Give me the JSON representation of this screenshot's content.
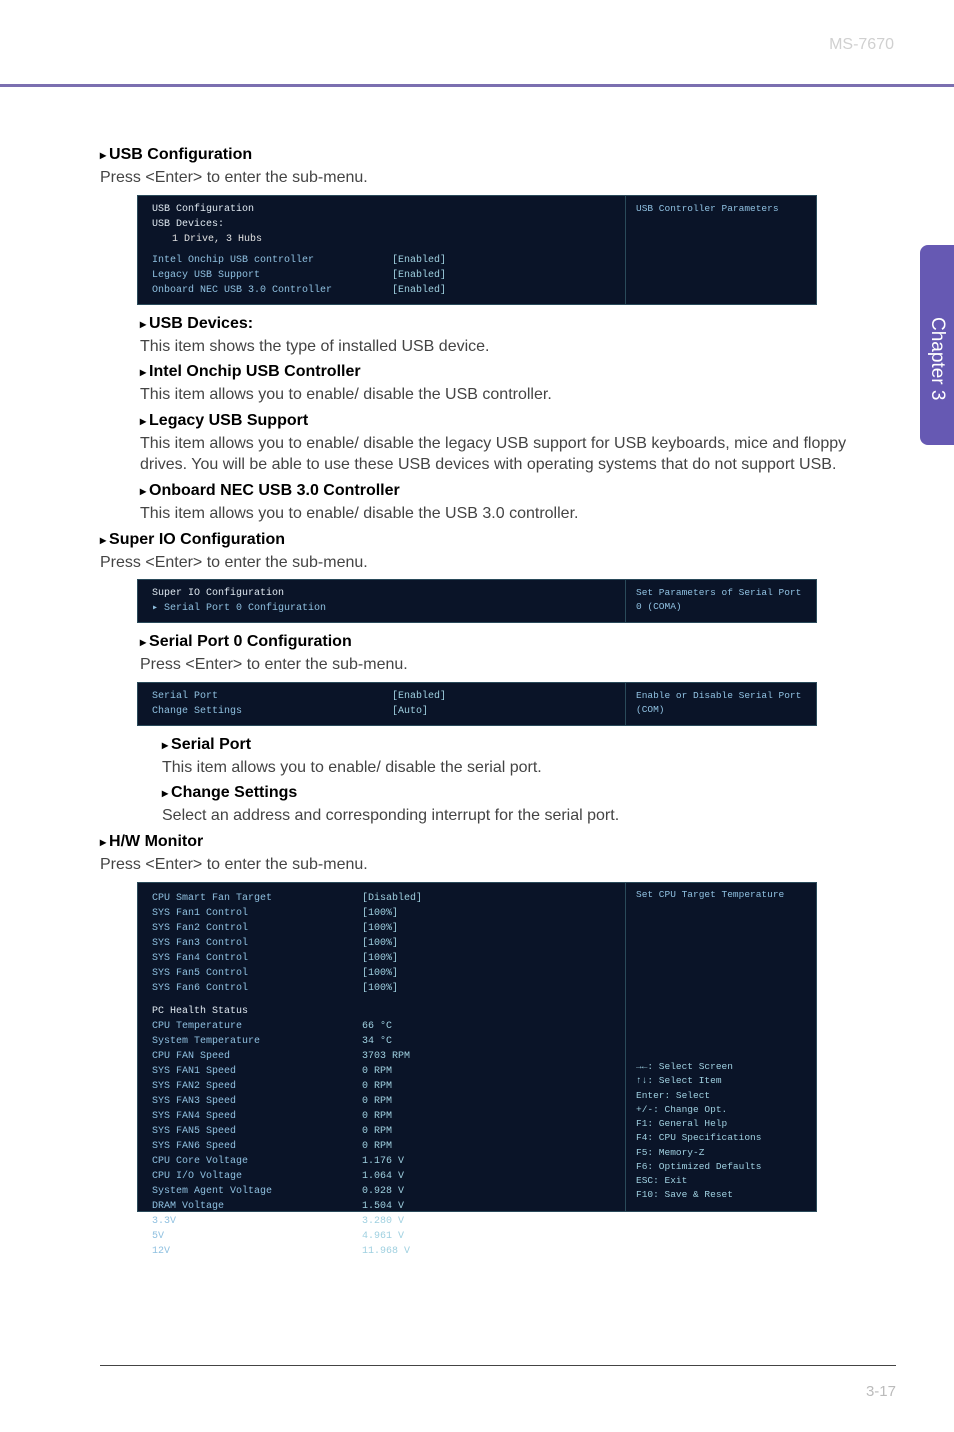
{
  "header": {
    "model": "MS-7670"
  },
  "sideTab": "Chapter 3",
  "sect_usb": {
    "title": "USB Configuration",
    "desc": "Press <Enter> to enter the sub-menu."
  },
  "bios_usb": {
    "group": "USB Configuration",
    "devices_label": "USB Devices:",
    "devices_value": "1 Drive, 3 Hubs",
    "rows": [
      {
        "lbl": "Intel Onchip USB controller",
        "val": "[Enabled]"
      },
      {
        "lbl": "Legacy USB Support",
        "val": "[Enabled]"
      },
      {
        "lbl": "Onboard NEC USB 3.0 Controller",
        "val": "[Enabled]"
      }
    ],
    "help": "USB Controller Parameters"
  },
  "sub_usb_devices": {
    "title": "USB Devices:",
    "desc": "This item shows the type of installed USB device."
  },
  "sub_intel_onchip": {
    "title": "Intel Onchip USB Controller",
    "desc": "This item allows you to enable/ disable the USB controller."
  },
  "sub_legacy": {
    "title": "Legacy USB Support",
    "desc": "This item allows you to enable/ disable the legacy USB support for USB keyboards, mice and floppy drives. You will be able to use these USB devices with operating systems that do not support USB."
  },
  "sub_onboard_nec": {
    "title": "Onboard NEC USB 3.0 Controller",
    "desc": "This item allows you to enable/ disable the USB 3.0 controller."
  },
  "sect_superio": {
    "title": "Super IO Configuration",
    "desc": "Press <Enter> to enter the sub-menu."
  },
  "bios_superio": {
    "rows": [
      {
        "lbl": "Super IO Configuration",
        "val": ""
      },
      {
        "lbl": "▸ Serial Port 0 Configuration",
        "val": ""
      }
    ],
    "help": "Set Parameters of Serial Port 0 (COMA)"
  },
  "sub_serial0": {
    "title": "Serial Port 0 Configuration",
    "desc": "Press <Enter> to enter the sub-menu."
  },
  "bios_serial": {
    "rows": [
      {
        "lbl": "Serial Port",
        "val": "[Enabled]"
      },
      {
        "lbl": "Change Settings",
        "val": "[Auto]"
      }
    ],
    "help": "Enable or Disable Serial Port (COM)"
  },
  "sub_serialport": {
    "title": "Serial Port",
    "desc": "This item allows you to enable/ disable the serial port."
  },
  "sub_changesettings": {
    "title": "Change Settings",
    "desc": "Select an address and corresponding interrupt for the serial port."
  },
  "sect_hw": {
    "title": "H/W Monitor",
    "desc": "Press <Enter> to enter the sub-menu."
  },
  "bios_hw": {
    "rows1": [
      {
        "lbl": "CPU Smart Fan Target",
        "val": "[Disabled]",
        "gold": true
      },
      {
        "lbl": "SYS Fan1 Control",
        "val": "[100%]"
      },
      {
        "lbl": "SYS Fan2 Control",
        "val": "[100%]"
      },
      {
        "lbl": "SYS Fan3 Control",
        "val": "[100%]"
      },
      {
        "lbl": "SYS Fan4 Control",
        "val": "[100%]"
      },
      {
        "lbl": "SYS Fan5 Control",
        "val": "[100%]"
      },
      {
        "lbl": "SYS Fan6 Control",
        "val": "[100%]"
      }
    ],
    "health_label": "PC Health Status",
    "rows2": [
      {
        "lbl": "CPU Temperature",
        "val": "66 °C"
      },
      {
        "lbl": "System Temperature",
        "val": "34 °C"
      },
      {
        "lbl": "CPU FAN Speed",
        "val": "3703 RPM"
      },
      {
        "lbl": "SYS FAN1 Speed",
        "val": "0 RPM"
      },
      {
        "lbl": "SYS FAN2 Speed",
        "val": "0 RPM"
      },
      {
        "lbl": "SYS FAN3 Speed",
        "val": "0 RPM"
      },
      {
        "lbl": "SYS FAN4 Speed",
        "val": "0 RPM"
      },
      {
        "lbl": "SYS FAN5 Speed",
        "val": "0 RPM"
      },
      {
        "lbl": "SYS FAN6 Speed",
        "val": "0 RPM"
      },
      {
        "lbl": "CPU Core Voltage",
        "val": "1.176 V"
      },
      {
        "lbl": "CPU I/O Voltage",
        "val": "1.064 V"
      },
      {
        "lbl": "System Agent Voltage",
        "val": "0.928 V"
      },
      {
        "lbl": "DRAM Voltage",
        "val": "1.504 V"
      },
      {
        "lbl": "3.3V",
        "val": "3.280 V"
      },
      {
        "lbl": "5V",
        "val": "4.961 V"
      },
      {
        "lbl": "12V",
        "val": "11.968 V"
      }
    ],
    "help": "Set CPU Target Temperature",
    "nav": [
      "→←: Select Screen",
      "↑↓: Select Item",
      "Enter: Select",
      "+/-: Change Opt.",
      "F1: General Help",
      "F4: CPU Specifications",
      "F5: Memory-Z",
      "F6: Optimized Defaults",
      "ESC: Exit",
      "F10: Save & Reset"
    ]
  },
  "footer": "3-17"
}
